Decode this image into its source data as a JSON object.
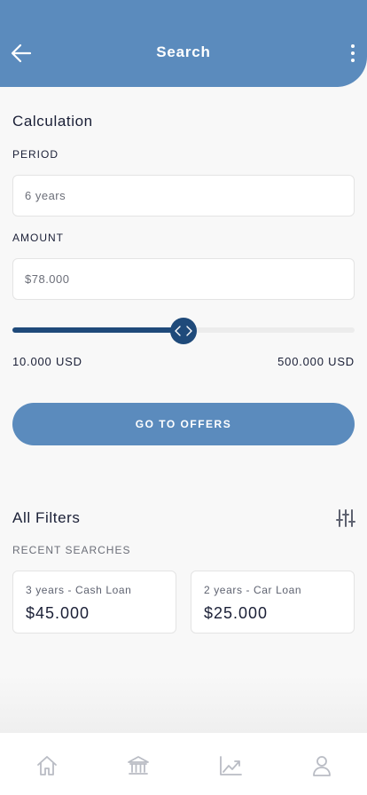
{
  "header": {
    "title": "Search",
    "back_icon": "arrow-left-icon",
    "menu_icon": "more-vertical-icon",
    "background": "#5b8bbd"
  },
  "calculation": {
    "title": "Calculation",
    "period": {
      "label": "PERIOD",
      "value": "6 years"
    },
    "amount": {
      "label": "AMOUNT",
      "value": "$78.000"
    },
    "slider": {
      "min_label": "10.000 USD",
      "max_label": "500.000 USD",
      "fraction": 0.5,
      "fill_color": "#1f4a7a",
      "track_color": "#ececec"
    },
    "cta_label": "GO TO OFFERS"
  },
  "filters": {
    "title": "All Filters",
    "icon": "sliders-icon",
    "recent_label": "RECENT SEARCHES",
    "recent": [
      {
        "subtitle": "3 years - Cash Loan",
        "value": "$45.000"
      },
      {
        "subtitle": "2 years - Car Loan",
        "value": "$25.000"
      }
    ]
  },
  "tabbar": {
    "items": [
      {
        "icon": "home-icon"
      },
      {
        "icon": "bank-icon"
      },
      {
        "icon": "chart-line-icon"
      },
      {
        "icon": "user-icon"
      }
    ],
    "icon_color": "#b9bcc4"
  }
}
